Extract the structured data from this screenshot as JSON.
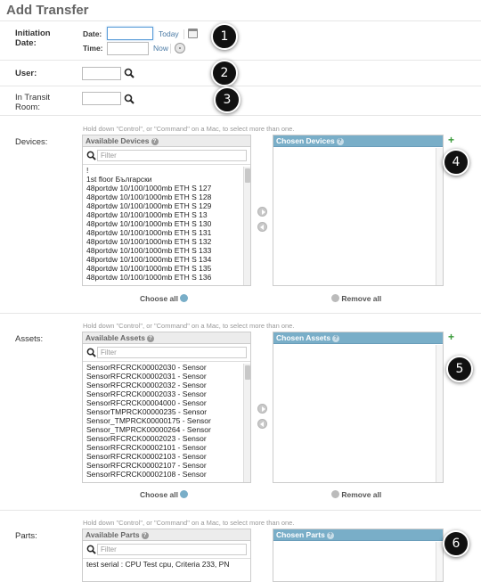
{
  "page": {
    "title": "Add Transfer"
  },
  "initiation": {
    "label": "Initiation Date:",
    "date_label": "Date:",
    "date_value": "",
    "today_link": "Today",
    "time_label": "Time:",
    "time_value": "",
    "now_link": "Now"
  },
  "user": {
    "label": "User:",
    "value": ""
  },
  "in_transit": {
    "label": "In Transit Room:",
    "value": ""
  },
  "help_text": "Hold down \"Control\", or \"Command\" on a Mac, to select more than one.",
  "devices": {
    "label": "Devices:",
    "available_title": "Available Devices",
    "chosen_title": "Chosen Devices",
    "filter_placeholder": "Filter",
    "choose_all": "Choose all",
    "remove_all": "Remove all",
    "options": [
      "!",
      "1st floor Български",
      "48portdw 10/100/1000mb ETH S 127",
      "48portdw 10/100/1000mb ETH S 128",
      "48portdw 10/100/1000mb ETH S 129",
      "48portdw 10/100/1000mb ETH S 13",
      "48portdw 10/100/1000mb ETH S 130",
      "48portdw 10/100/1000mb ETH S 131",
      "48portdw 10/100/1000mb ETH S 132",
      "48portdw 10/100/1000mb ETH S 133",
      "48portdw 10/100/1000mb ETH S 134",
      "48portdw 10/100/1000mb ETH S 135",
      "48portdw 10/100/1000mb ETH S 136"
    ]
  },
  "assets": {
    "label": "Assets:",
    "available_title": "Available Assets",
    "chosen_title": "Chosen Assets",
    "filter_placeholder": "Filter",
    "choose_all": "Choose all",
    "remove_all": "Remove all",
    "options": [
      "SensorRFCRCK00002030 - Sensor",
      "SensorRFCRCK00002031 - Sensor",
      "SensorRFCRCK00002032 - Sensor",
      "SensorRFCRCK00002033 - Sensor",
      "SensorRFCRCK00004000 - Sensor",
      "SensorTMPRCK00000235 - Sensor",
      "Sensor_TMPRCK00000175 - Sensor",
      "Sensor_TMPRCK00000264 - Sensor",
      "SensorRFCRCK00002023 - Sensor",
      "SensorRFCRCK00002101 - Sensor",
      "SensorRFCRCK00002103 - Sensor",
      "SensorRFCRCK00002107 - Sensor",
      "SensorRFCRCK00002108 - Sensor"
    ]
  },
  "parts": {
    "label": "Parts:",
    "available_title": "Available Parts",
    "chosen_title": "Chosen Parts",
    "filter_placeholder": "Filter",
    "options": [
      "test serial : CPU Test cpu, Criteria 233, PN"
    ]
  },
  "markers": [
    "1",
    "2",
    "3",
    "4",
    "5",
    "6"
  ],
  "colors": {
    "chosen_header": "#79aec8",
    "link": "#4a7aa5",
    "add_icon": "#3a9a3a"
  }
}
